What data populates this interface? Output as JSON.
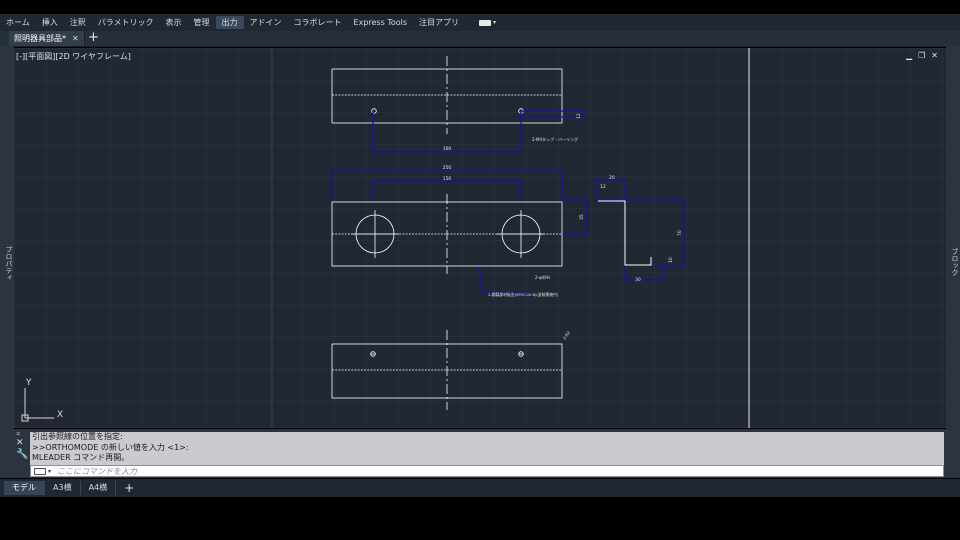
{
  "ribbon": {
    "tabs": [
      "ホーム",
      "挿入",
      "注釈",
      "パラメトリック",
      "表示",
      "管理",
      "出力",
      "アドイン",
      "コラボレート",
      "Express Tools",
      "注目アプリ"
    ],
    "active_tab": "出力"
  },
  "document": {
    "tab_label": "照明器具部品*",
    "close": "✕",
    "new_tab": "+"
  },
  "viewport": {
    "label": "[-][平面図][2D ワイヤフレーム]",
    "minimize": "▁",
    "restore": "❐",
    "close": "✕",
    "axis_x": "X",
    "axis_y": "Y"
  },
  "palettes": {
    "left": "プロパティ",
    "right": "ブロック"
  },
  "drawing": {
    "dim_160": "160",
    "dim_250": "250",
    "dim_150": "150",
    "dim_35": "35",
    "dim_12a": "12",
    "dim_12b": "12",
    "dim_20": "20",
    "dim_70": "70",
    "dim_10": "10",
    "dim_30": "30",
    "note_tap": "2-M4タップ・バーリング",
    "note_hole": "2-φ40H",
    "note_material": "2-鋼製部材板金(SPCC-t0.8)(塗装黒焼付)",
    "note_bend": "2-R2"
  },
  "command": {
    "history": [
      "引出参照線の位置を指定:",
      ">>ORTHOMODE の新しい値を入力 <1>:",
      "MLEADER コマンド再開。"
    ],
    "placeholder": "ここにコマンドを入力"
  },
  "layouts": {
    "tabs": [
      "モデル",
      "A3横",
      "A4横"
    ],
    "active": "モデル",
    "add": "+"
  },
  "colors": {
    "viewport_bg": "#212833",
    "dimension": "#1414a8",
    "geometry": "#ffffff"
  }
}
